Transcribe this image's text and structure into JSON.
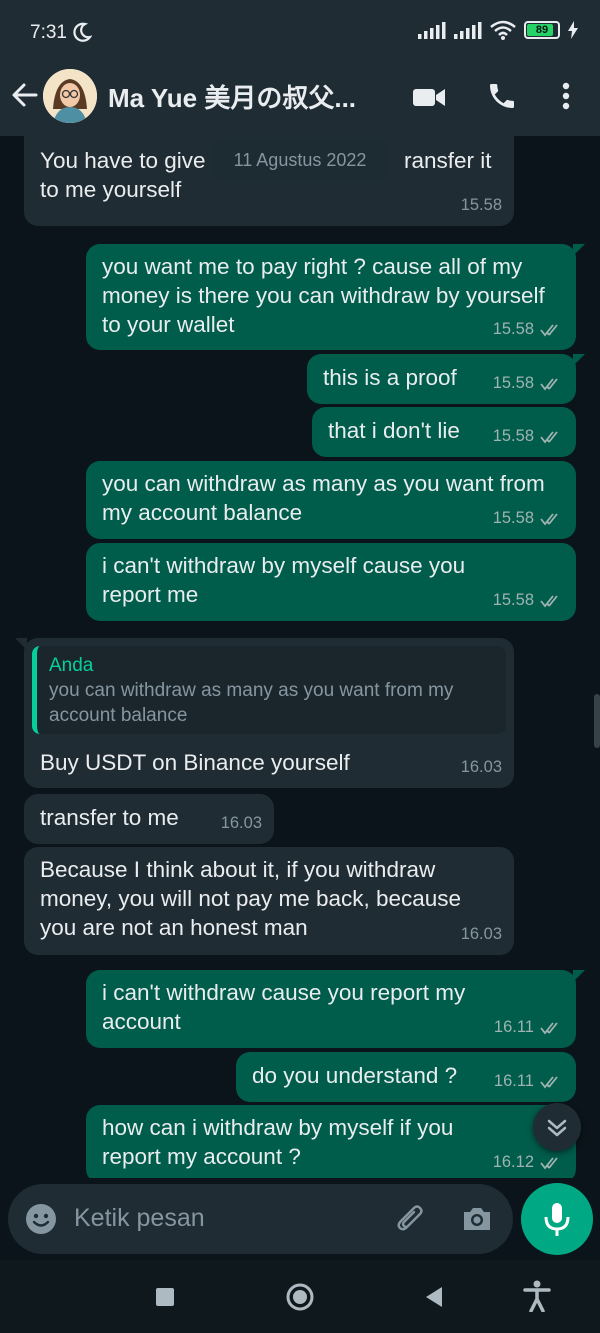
{
  "status_bar": {
    "time": "7:31",
    "battery": "89"
  },
  "header": {
    "contact_name": "Ma Yue 美月の叔父..."
  },
  "chat": {
    "date_label": "11 Agustus 2022",
    "top_partial": {
      "text_left": "You have to give",
      "text_right": "ransfer it",
      "text_line2": "to me yourself",
      "time": "15.58"
    },
    "messages": [
      {
        "dir": "out",
        "text": "you want me to pay right ? cause all of my money is there you can withdraw by yourself to your wallet",
        "time": "15.58"
      },
      {
        "dir": "out",
        "text": "this is a proof",
        "time": "15.58"
      },
      {
        "dir": "out",
        "text": "that i don't lie",
        "time": "15.58"
      },
      {
        "dir": "out",
        "text": "you can withdraw as many as you want from my account balance",
        "time": "15.58"
      },
      {
        "dir": "out",
        "text": "i can't withdraw by myself cause you report me",
        "time": "15.58"
      },
      {
        "dir": "in",
        "quote_author": "Anda",
        "quote_text": "you can withdraw as many as you want from my account balance",
        "text": "Buy USDT on Binance yourself",
        "time": "16.03"
      },
      {
        "dir": "in",
        "text": "transfer to me",
        "time": "16.03"
      },
      {
        "dir": "in",
        "text": "Because I think about it, if you withdraw money, you will not pay me back, because you are not an honest man",
        "time": "16.03"
      },
      {
        "dir": "out",
        "text": "i can't withdraw cause you report my account",
        "time": "16.11"
      },
      {
        "dir": "out",
        "text": "do you understand ?",
        "time": "16.11"
      },
      {
        "dir": "out",
        "text": "how can i withdraw by myself if you report my account ?",
        "time": "16.12"
      }
    ]
  },
  "composer": {
    "placeholder": "Ketik pesan"
  },
  "icons": {
    "back": "arrow-left-icon",
    "video": "video-call-icon",
    "call": "phone-icon",
    "menu": "more-vert-icon",
    "emoji": "emoji-icon",
    "attach": "paperclip-icon",
    "camera": "camera-icon",
    "mic": "mic-icon",
    "scroll": "double-chevron-down-icon",
    "read": "double-check-icon"
  },
  "colors": {
    "background": "#0b141a",
    "bar": "#1f2c34",
    "incoming": "#202c33",
    "outgoing": "#005c4b",
    "accent": "#00a884",
    "quote_accent": "#06cf9c"
  }
}
